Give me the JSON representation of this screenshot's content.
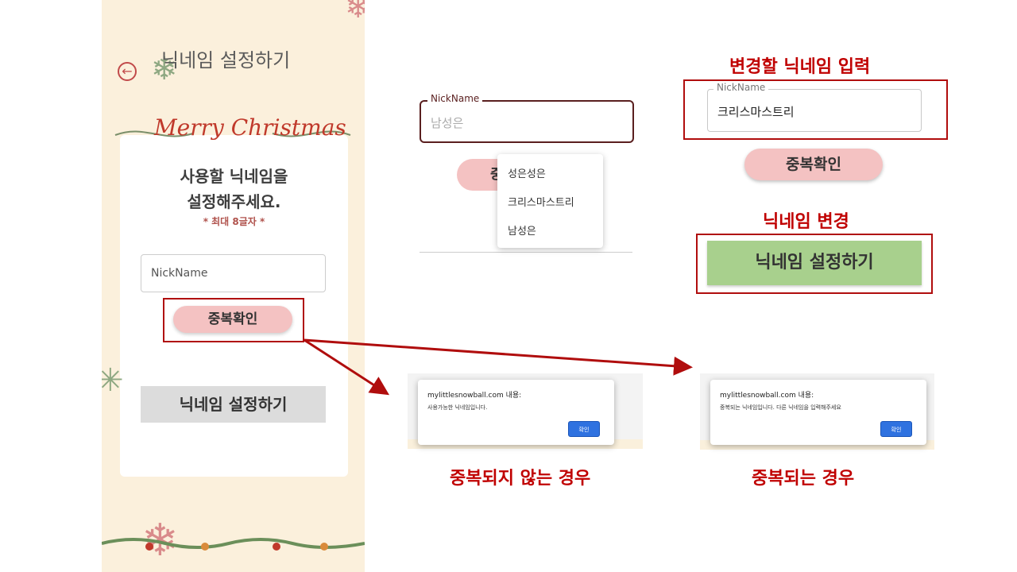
{
  "phone": {
    "title": "닉네임 설정하기",
    "banner": "Merry Christmas",
    "prompt_line1": "사용할 닉네임을",
    "prompt_line2": "설정해주세요.",
    "max_length_note": "* 최대 8글자 *",
    "nickname_placeholder": "NickName",
    "dup_check_button": "중복확인",
    "set_button": "닉네임 설정하기"
  },
  "autocomplete_demo": {
    "field_label": "NickName",
    "field_value": "남성은",
    "button_partial": "중",
    "suggestions": [
      "성은성은",
      "크리스마스트리",
      "남성은"
    ]
  },
  "right_panel": {
    "heading_input": "변경할 닉네임 입력",
    "field_label": "NickName",
    "field_value": "크리스마스트리",
    "dup_check_button": "중복확인",
    "heading_change": "닉네임 변경",
    "set_button": "닉네임 설정하기"
  },
  "alerts": {
    "available": {
      "title": "mylittlesnowball.com 내용:",
      "message": "사용가능한 닉네임입니다.",
      "ok": "확인",
      "caption": "중복되지 않는 경우"
    },
    "duplicate": {
      "title": "mylittlesnowball.com 내용:",
      "message": "중복되는 닉네임입니다. 다른 닉네임을 입력해주세요",
      "ok": "확인",
      "caption": "중복되는 경우"
    }
  },
  "colors": {
    "accent_red": "#c00000",
    "pink_button": "#f4c2c2",
    "green_button": "#a8d08d",
    "cream_bg": "#fbf0dc"
  }
}
